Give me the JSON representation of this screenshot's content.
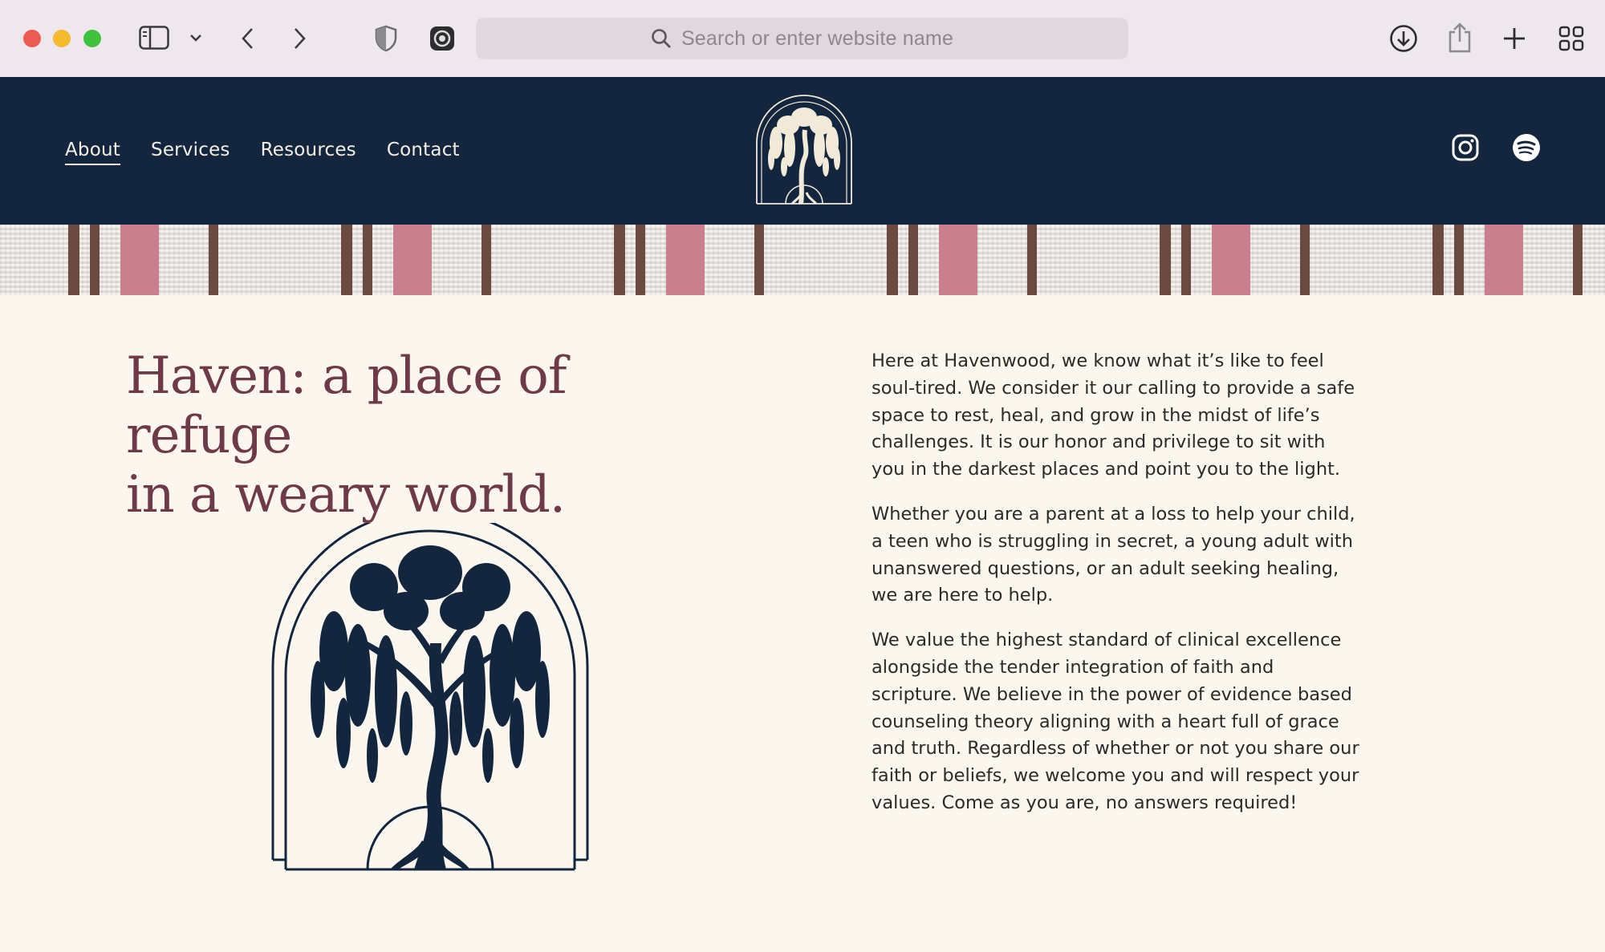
{
  "browser": {
    "url_placeholder": "Search or enter website name",
    "traffic_lights": [
      "#ee5a52",
      "#f4bb2f",
      "#3fc13f"
    ]
  },
  "site": {
    "nav": [
      {
        "label": "About",
        "active": true
      },
      {
        "label": "Services",
        "active": false
      },
      {
        "label": "Resources",
        "active": false
      },
      {
        "label": "Contact",
        "active": false
      }
    ],
    "social": [
      "instagram-icon",
      "spotify-icon"
    ],
    "colors": {
      "header_bg": "#13263d",
      "page_bg": "#fbf7ee",
      "headline": "#6e3a47",
      "tree": "#13263d"
    }
  },
  "main": {
    "headline_line1": "Haven: a place of refuge",
    "headline_line2": "in a weary world.",
    "paragraphs": [
      "Here at Havenwood, we know what it’s like to feel soul-tired. We consider it our calling to provide a safe space to rest, heal, and grow in the midst of life’s challenges. It is our honor and privilege to sit with you in the darkest places and point you to the light.",
      "Whether you are a parent at a loss to help your child, a teen who is struggling in secret, a young adult with unanswered questions, or an adult seeking healing, we are here to help.",
      "We value the highest standard of clinical excellence alongside the tender integration of faith and scripture. We believe in the power of evidence based counseling theory aligning with a heart full of grace and truth. Regardless of whether or not you share our faith or beliefs, we welcome you and will respect your values. Come as you are, no answers required!"
    ]
  }
}
